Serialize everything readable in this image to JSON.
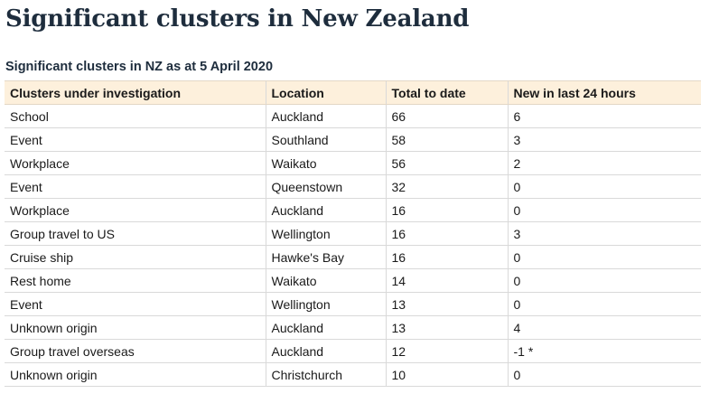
{
  "page": {
    "title": "Significant clusters in New Zealand"
  },
  "table": {
    "caption": "Significant clusters in NZ as at 5 April 2020",
    "headers": [
      "Clusters under investigation",
      "Location",
      "Total to date",
      "New in last 24 hours"
    ],
    "rows": [
      [
        "School",
        "Auckland",
        "66",
        "6"
      ],
      [
        "Event",
        "Southland",
        "58",
        "3"
      ],
      [
        "Workplace",
        "Waikato",
        "56",
        "2"
      ],
      [
        "Event",
        "Queenstown",
        "32",
        "0"
      ],
      [
        "Workplace",
        "Auckland",
        "16",
        "0"
      ],
      [
        "Group travel to US",
        "Wellington",
        "16",
        "3"
      ],
      [
        "Cruise ship",
        "Hawke's Bay",
        "16",
        "0"
      ],
      [
        "Rest home",
        "Waikato",
        "14",
        "0"
      ],
      [
        "Event",
        "Wellington",
        "13",
        "0"
      ],
      [
        "Unknown origin",
        "Auckland",
        "13",
        "4"
      ],
      [
        "Group travel overseas",
        "Auckland",
        "12",
        "-1 *"
      ],
      [
        "Unknown origin",
        "Christchurch",
        "10",
        "0"
      ]
    ]
  },
  "colors": {
    "title": "#1e2d3d",
    "header_background": "#fdf0dc",
    "row_border": "#d9d9d9"
  }
}
